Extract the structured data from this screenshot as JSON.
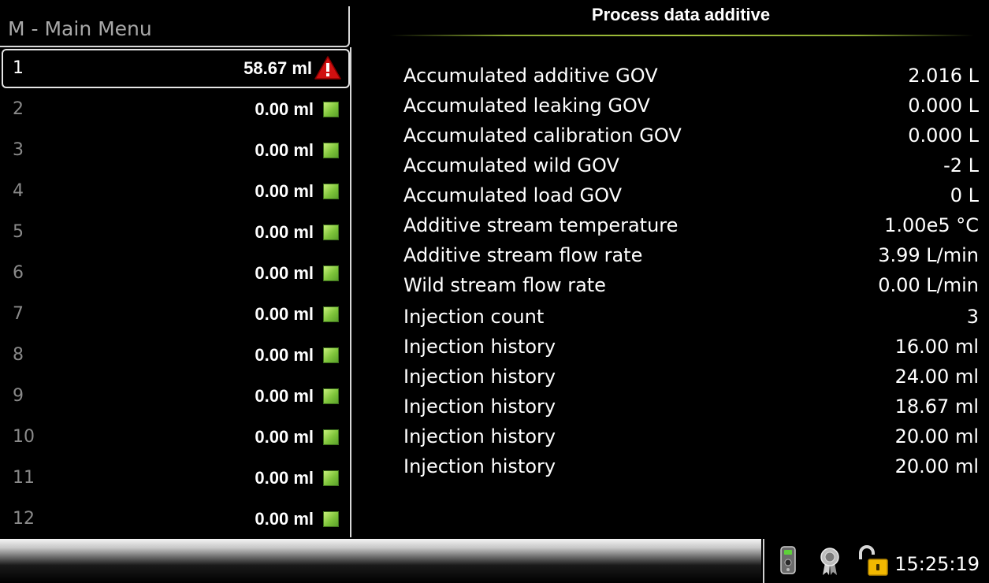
{
  "menu": {
    "title": "M - Main Menu"
  },
  "list": [
    {
      "num": "1",
      "value": "58.67 ml",
      "status": "warning-icon"
    },
    {
      "num": "2",
      "value": "0.00 ml",
      "status": "ok-indicator"
    },
    {
      "num": "3",
      "value": "0.00 ml",
      "status": "ok-indicator"
    },
    {
      "num": "4",
      "value": "0.00 ml",
      "status": "ok-indicator"
    },
    {
      "num": "5",
      "value": "0.00 ml",
      "status": "ok-indicator"
    },
    {
      "num": "6",
      "value": "0.00 ml",
      "status": "ok-indicator"
    },
    {
      "num": "7",
      "value": "0.00 ml",
      "status": "ok-indicator"
    },
    {
      "num": "8",
      "value": "0.00 ml",
      "status": "ok-indicator"
    },
    {
      "num": "9",
      "value": "0.00 ml",
      "status": "ok-indicator"
    },
    {
      "num": "10",
      "value": "0.00 ml",
      "status": "ok-indicator"
    },
    {
      "num": "11",
      "value": "0.00 ml",
      "status": "ok-indicator"
    },
    {
      "num": "12",
      "value": "0.00 ml",
      "status": "ok-indicator"
    }
  ],
  "panel": {
    "title": "Process data additive",
    "rows": [
      {
        "label": "Accumulated additive GOV",
        "value": "2.016 L"
      },
      {
        "label": "Accumulated leaking GOV",
        "value": "0.000 L"
      },
      {
        "label": "Accumulated calibration GOV",
        "value": "0.000 L"
      },
      {
        "label": "Accumulated wild GOV",
        "value": "-2 L"
      },
      {
        "label": "Accumulated load GOV",
        "value": "0 L"
      },
      {
        "label": "Additive stream temperature",
        "value": "1.00e5 °C"
      },
      {
        "label": "Additive stream flow rate",
        "value": "3.99 L/min"
      },
      {
        "label": "Wild stream flow rate",
        "value": "0.00 L/min"
      },
      {
        "label": "Injection count",
        "value": "3"
      },
      {
        "label": "Injection history",
        "value": "16.00 ml"
      },
      {
        "label": "Injection history",
        "value": "24.00 ml"
      },
      {
        "label": "Injection history",
        "value": "18.67 ml"
      },
      {
        "label": "Injection history",
        "value": "20.00 ml"
      },
      {
        "label": "Injection history",
        "value": "20.00 ml"
      }
    ]
  },
  "statusbar": {
    "time": "15:25:19",
    "icons": [
      "remote-control-icon",
      "certificate-icon",
      "padlock-icon"
    ]
  },
  "colors": {
    "ok": "#7ec43a",
    "warning": "#d01010",
    "accent_line": "#a4c23c"
  }
}
